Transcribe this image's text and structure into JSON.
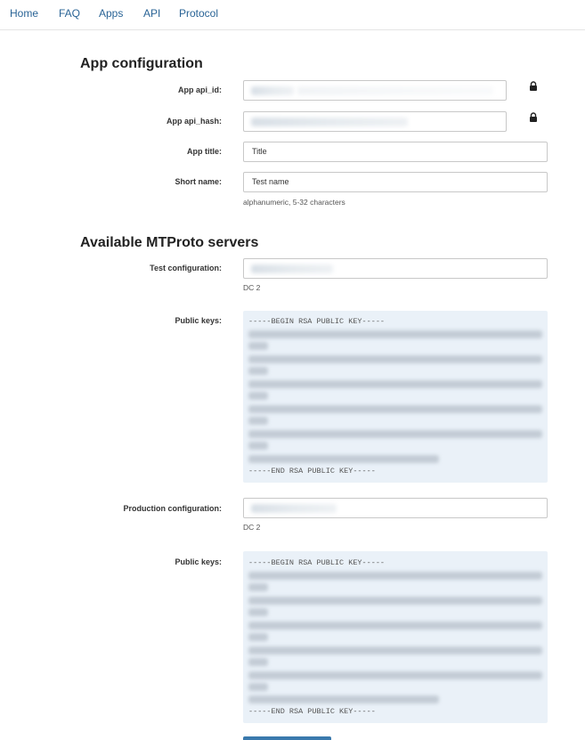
{
  "nav": {
    "items": [
      {
        "label": "Home"
      },
      {
        "label": "FAQ"
      },
      {
        "label": "Apps"
      },
      {
        "label": "API"
      },
      {
        "label": "Protocol"
      }
    ]
  },
  "app_config": {
    "title": "App configuration",
    "fields": {
      "api_id": {
        "label": "App api_id:"
      },
      "api_hash": {
        "label": "App api_hash:"
      },
      "app_title": {
        "label": "App title:",
        "value": "Title"
      },
      "short_name": {
        "label": "Short name:",
        "value": "Test name",
        "help": "alphanumeric, 5-32 characters"
      }
    }
  },
  "servers": {
    "title": "Available MTProto servers",
    "test": {
      "label": "Test configuration:",
      "dc": "DC 2",
      "keys_label": "Public keys:",
      "key_begin": "-----BEGIN RSA PUBLIC KEY-----",
      "key_end": "-----END RSA PUBLIC KEY-----"
    },
    "production": {
      "label": "Production configuration:",
      "dc": "DC 2",
      "keys_label": "Public keys:",
      "key_begin": "-----BEGIN RSA PUBLIC KEY-----",
      "key_end": "-----END RSA PUBLIC KEY-----"
    }
  },
  "colors": {
    "link": "#2a6496",
    "key_background": "#eaf1f8",
    "button": "#3a79ad"
  },
  "icons": {
    "lock": "lock-icon"
  }
}
